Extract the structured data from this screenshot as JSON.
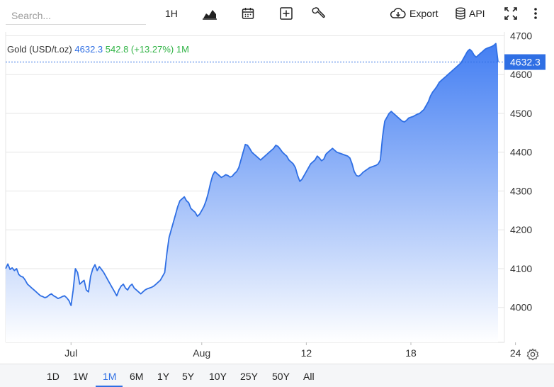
{
  "search": {
    "placeholder": "Search..."
  },
  "toolbar": {
    "interval": "1H",
    "export_label": "Export",
    "api_label": "API"
  },
  "info": {
    "symbol": "Gold (USD/t.oz)",
    "price": "4632.3",
    "change": "542.8 (+13.27%)",
    "period": "1M"
  },
  "ranges": [
    "1D",
    "1W",
    "1M",
    "6M",
    "1Y",
    "5Y",
    "10Y",
    "25Y",
    "50Y",
    "All"
  ],
  "active_range": "1M",
  "colors": {
    "line": "#2f6fe4",
    "fill_top": "#3a78f2",
    "fill_bottom": "#ffffff",
    "price_tag": "#2f6fe4",
    "change": "#2fb344"
  },
  "chart_data": {
    "type": "area",
    "title": "Gold (USD/t.oz)",
    "ylim": [
      3910,
      4710
    ],
    "yticks": [
      4000,
      4100,
      4200,
      4300,
      4400,
      4500,
      4600,
      4700
    ],
    "xtick_labels": [
      "Jul",
      "Aug",
      "12",
      "18",
      "24"
    ],
    "xtick_indices": [
      30,
      90,
      138,
      186,
      234
    ],
    "last_value": 4632.3,
    "values": [
      4100,
      4112,
      4098,
      4102,
      4095,
      4100,
      4085,
      4080,
      4078,
      4070,
      4060,
      4055,
      4050,
      4045,
      4040,
      4035,
      4030,
      4028,
      4025,
      4027,
      4032,
      4035,
      4030,
      4027,
      4023,
      4025,
      4028,
      4030,
      4025,
      4018,
      4005,
      4045,
      4100,
      4090,
      4060,
      4065,
      4070,
      4045,
      4040,
      4080,
      4100,
      4110,
      4095,
      4105,
      4098,
      4090,
      4080,
      4070,
      4060,
      4050,
      4040,
      4030,
      4045,
      4055,
      4060,
      4050,
      4045,
      4055,
      4060,
      4050,
      4045,
      4040,
      4035,
      4040,
      4045,
      4048,
      4050,
      4052,
      4055,
      4060,
      4065,
      4070,
      4080,
      4090,
      4140,
      4180,
      4200,
      4220,
      4240,
      4260,
      4275,
      4280,
      4285,
      4275,
      4270,
      4255,
      4250,
      4245,
      4235,
      4240,
      4250,
      4260,
      4275,
      4295,
      4320,
      4340,
      4350,
      4345,
      4340,
      4335,
      4338,
      4342,
      4340,
      4336,
      4338,
      4345,
      4350,
      4360,
      4380,
      4400,
      4420,
      4418,
      4410,
      4400,
      4395,
      4390,
      4385,
      4380,
      4385,
      4390,
      4395,
      4400,
      4405,
      4410,
      4418,
      4415,
      4408,
      4400,
      4395,
      4390,
      4380,
      4375,
      4370,
      4360,
      4340,
      4325,
      4330,
      4340,
      4350,
      4360,
      4370,
      4375,
      4380,
      4390,
      4385,
      4378,
      4382,
      4395,
      4400,
      4405,
      4410,
      4405,
      4400,
      4398,
      4396,
      4394,
      4392,
      4390,
      4385,
      4370,
      4350,
      4340,
      4338,
      4342,
      4348,
      4352,
      4356,
      4360,
      4362,
      4364,
      4366,
      4370,
      4380,
      4440,
      4480,
      4490,
      4500,
      4505,
      4500,
      4495,
      4490,
      4485,
      4480,
      4478,
      4482,
      4488,
      4490,
      4492,
      4495,
      4498,
      4500,
      4505,
      4510,
      4520,
      4530,
      4545,
      4555,
      4562,
      4570,
      4580,
      4585,
      4590,
      4595,
      4600,
      4605,
      4610,
      4615,
      4620,
      4625,
      4630,
      4640,
      4650,
      4660,
      4665,
      4660,
      4650,
      4645,
      4650,
      4655,
      4660,
      4665,
      4668,
      4670,
      4672,
      4675,
      4680,
      4632.3
    ]
  }
}
